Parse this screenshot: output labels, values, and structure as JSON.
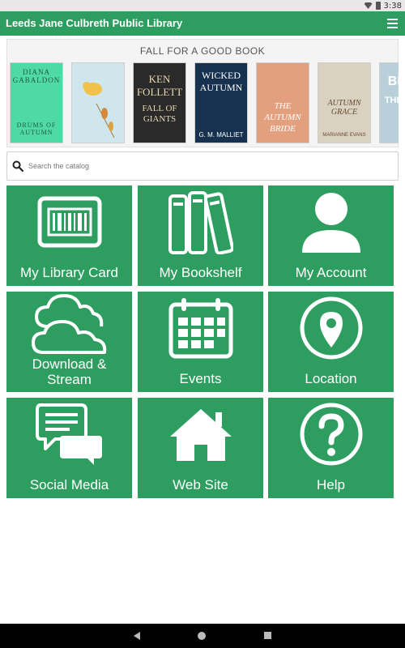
{
  "status_bar": {
    "time": "3:38"
  },
  "app_bar": {
    "title": "Leeds Jane Culbreth Public Library",
    "menu_icon": "hamburger-menu-icon"
  },
  "banner": {
    "heading": "FALL FOR A GOOD BOOK",
    "books": [
      {
        "line1": "DIANA GABALDON",
        "line2": "DRUMS OF AUTUMN",
        "bg": "#4fd9a4",
        "fg": "#1f5a45"
      },
      {
        "line1": "",
        "line2": "",
        "bg": "#cfe6ec",
        "fg": "#5a7a88"
      },
      {
        "line1": "KEN FOLLETT",
        "line2": "FALL OF GIANTS",
        "bg": "#2a2a2a",
        "fg": "#e8d9b0"
      },
      {
        "line1": "WICKED AUTUMN",
        "line2": "G. M. MALLIET",
        "bg": "#17324f",
        "fg": "#ffffff"
      },
      {
        "line1": "THE AUTUMN BRIDE",
        "line2": "",
        "bg": "#e3a07f",
        "fg": "#ffffff"
      },
      {
        "line1": "AUTUMN GRACE",
        "line2": "MARIANNE EVANS",
        "bg": "#d9d2c0",
        "fg": "#6a4a30"
      },
      {
        "line1": "BEFO",
        "line2": "THE FALL",
        "bg": "#b9d0da",
        "fg": "#ffffff"
      }
    ]
  },
  "search": {
    "placeholder": "Search the catalog",
    "icon": "search-icon"
  },
  "tiles": [
    {
      "label": "My Library Card",
      "icon": "barcode-card-icon"
    },
    {
      "label": "My Bookshelf",
      "icon": "bookshelf-icon"
    },
    {
      "label": "My Account",
      "icon": "person-icon"
    },
    {
      "label_line1": "Download &",
      "label_line2": "Stream",
      "icon": "cloud-icon"
    },
    {
      "label": "Events",
      "icon": "calendar-icon"
    },
    {
      "label": "Location",
      "icon": "location-pin-icon"
    },
    {
      "label": "Social Media",
      "icon": "chat-bubbles-icon"
    },
    {
      "label": "Web Site",
      "icon": "home-icon"
    },
    {
      "label": "Help",
      "icon": "question-icon"
    }
  ],
  "colors": {
    "brand": "#2e9e60",
    "tile_icon": "#ffffff"
  },
  "nav_bar": {
    "back_icon": "back-icon",
    "home_icon": "home-circle-icon",
    "recents_icon": "recents-icon"
  }
}
